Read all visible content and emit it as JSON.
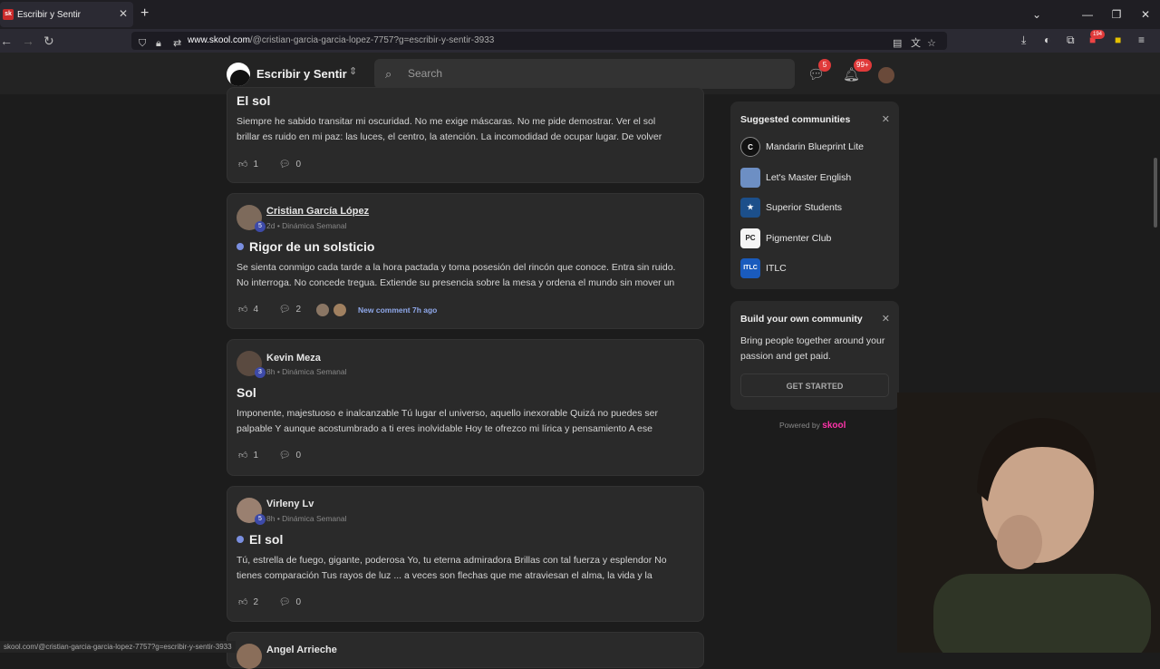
{
  "browser": {
    "tab_title": "Escribir y Sentir",
    "tab_favicon": "sk",
    "url_host": "www.skool.com",
    "url_path": "/@cristian-garcia-garcia-lopez-7757?g=escribir-y-sentir-3933",
    "ext_badge": "194",
    "status_url": "skool.com/@cristian-garcia-garcia-lopez-7757?g=escribir-y-sentir-3933"
  },
  "header": {
    "community_name": "Escribir y Sentir",
    "search_placeholder": "Search",
    "chat_badge": "5",
    "notif_badge": "99+"
  },
  "posts": [
    {
      "title": "El sol",
      "body1": "Siempre he sabido transitar mi oscuridad. No me exige máscaras. No me pide demostrar. Ver el sol",
      "body2": "brillar es ruido en mi paz: las luces, el centro, la atención. La incomodidad de ocupar lugar. De volver",
      "likes": "1",
      "comments": "0"
    },
    {
      "author": "Cristian García López",
      "level": "5",
      "meta": "2d • Dinámica Semanal",
      "title": "Rigor de un solsticio",
      "body1": "Se sienta conmigo cada tarde a la hora pactada y toma posesión del rincón que conoce. Entra sin ruido.",
      "body2": "No interroga. No concede tregua. Extiende su presencia sobre la mesa y ordena el mundo sin mover un",
      "likes": "4",
      "comments": "2",
      "new_comment": "New comment 7h ago"
    },
    {
      "author": "Kevin Meza",
      "level": "3",
      "meta": "8h • Dinámica Semanal",
      "title": "Sol",
      "body1": "Imponente, majestuoso e inalcanzable Tú lugar el universo, aquello inexorable Quizá no puedes ser",
      "body2": "palpable Y aunque acostumbrado a ti eres inolvidable Hoy te ofrezco mi lírica y pensamiento A ese",
      "likes": "1",
      "comments": "0"
    },
    {
      "author": "Virleny Lv",
      "level": "5",
      "meta": "8h • Dinámica Semanal",
      "title": "El sol",
      "body1": "Tú, estrella de fuego, gigante, poderosa Yo, tu eterna admiradora Brillas con tal fuerza y esplendor No",
      "body2": "tienes comparación Tus rayos de luz ... a veces son flechas que me atraviesan el alma, la vida y la",
      "likes": "2",
      "comments": "0"
    },
    {
      "author": "Angel Arrieche"
    }
  ],
  "sidebar": {
    "suggested_title": "Suggested communities",
    "communities": [
      {
        "name": "Mandarin Blueprint Lite",
        "icon": "C",
        "color": "#111111"
      },
      {
        "name": "Let's Master English",
        "icon": "",
        "color": "#6d8fc4"
      },
      {
        "name": "Superior Students",
        "icon": "★",
        "color": "#1c4f8a"
      },
      {
        "name": "Pigmenter Club",
        "icon": "PC",
        "color": "#f5f5f5"
      },
      {
        "name": "ITLC",
        "icon": "ITLC",
        "color": "#1a5bbd"
      }
    ],
    "build_title": "Build your own community",
    "build_text": "Bring people together around your passion and get paid.",
    "get_started": "GET STARTED",
    "powered_by": "Powered by",
    "powered_brand": "skool"
  }
}
